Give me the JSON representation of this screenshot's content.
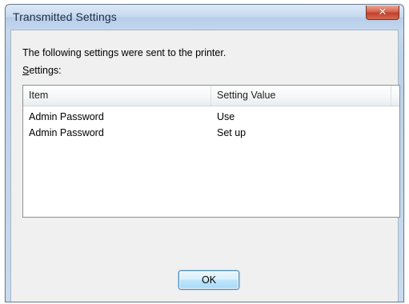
{
  "window": {
    "title": "Transmitted Settings",
    "close_icon": "close-icon"
  },
  "dialog": {
    "message": "The following settings were sent to the printer.",
    "settings_label_mnemonic": "S",
    "settings_label_rest": "ettings:"
  },
  "list": {
    "columns": [
      "Item",
      "Setting Value"
    ],
    "rows": [
      {
        "item": "Admin Password",
        "value": "Use"
      },
      {
        "item": "Admin Password",
        "value": "Set up"
      }
    ]
  },
  "buttons": {
    "ok_label": "OK"
  },
  "colors": {
    "close_button": "#c2412b",
    "ok_border": "#3c7fb1"
  }
}
